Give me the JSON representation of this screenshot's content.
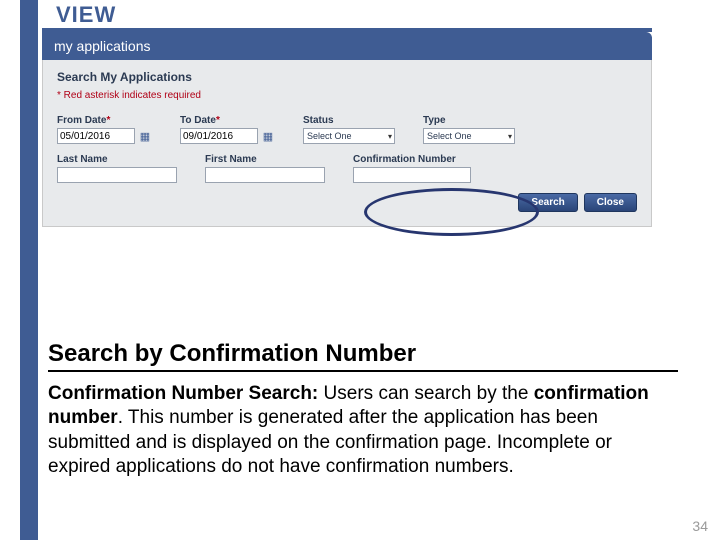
{
  "view_label": "VIEW",
  "panel": {
    "header": "my applications",
    "title": "Search My Applications",
    "required_note": "* Red asterisk indicates required",
    "fields": {
      "from_date": {
        "label": "From Date",
        "ast": "*",
        "value": "05/01/2016"
      },
      "to_date": {
        "label": "To Date",
        "ast": "*",
        "value": "09/01/2016"
      },
      "status": {
        "label": "Status",
        "value": "Select One"
      },
      "type": {
        "label": "Type",
        "value": "Select One"
      },
      "last_name": {
        "label": "Last Name",
        "value": ""
      },
      "first_name": {
        "label": "First Name",
        "value": ""
      },
      "confirmation_number": {
        "label": "Confirmation Number",
        "value": ""
      }
    },
    "buttons": {
      "search": "Search",
      "close": "Close"
    }
  },
  "doc": {
    "heading": "Search by Confirmation Number",
    "lead": "Confirmation Number Search:",
    "mid1": " Users can search by the ",
    "bold2": "confirmation number",
    "rest": ".  This number is generated after the application has been submitted and is displayed on the confirmation page. Incomplete or expired applications  do not have confirmation numbers."
  },
  "page_number": "34"
}
